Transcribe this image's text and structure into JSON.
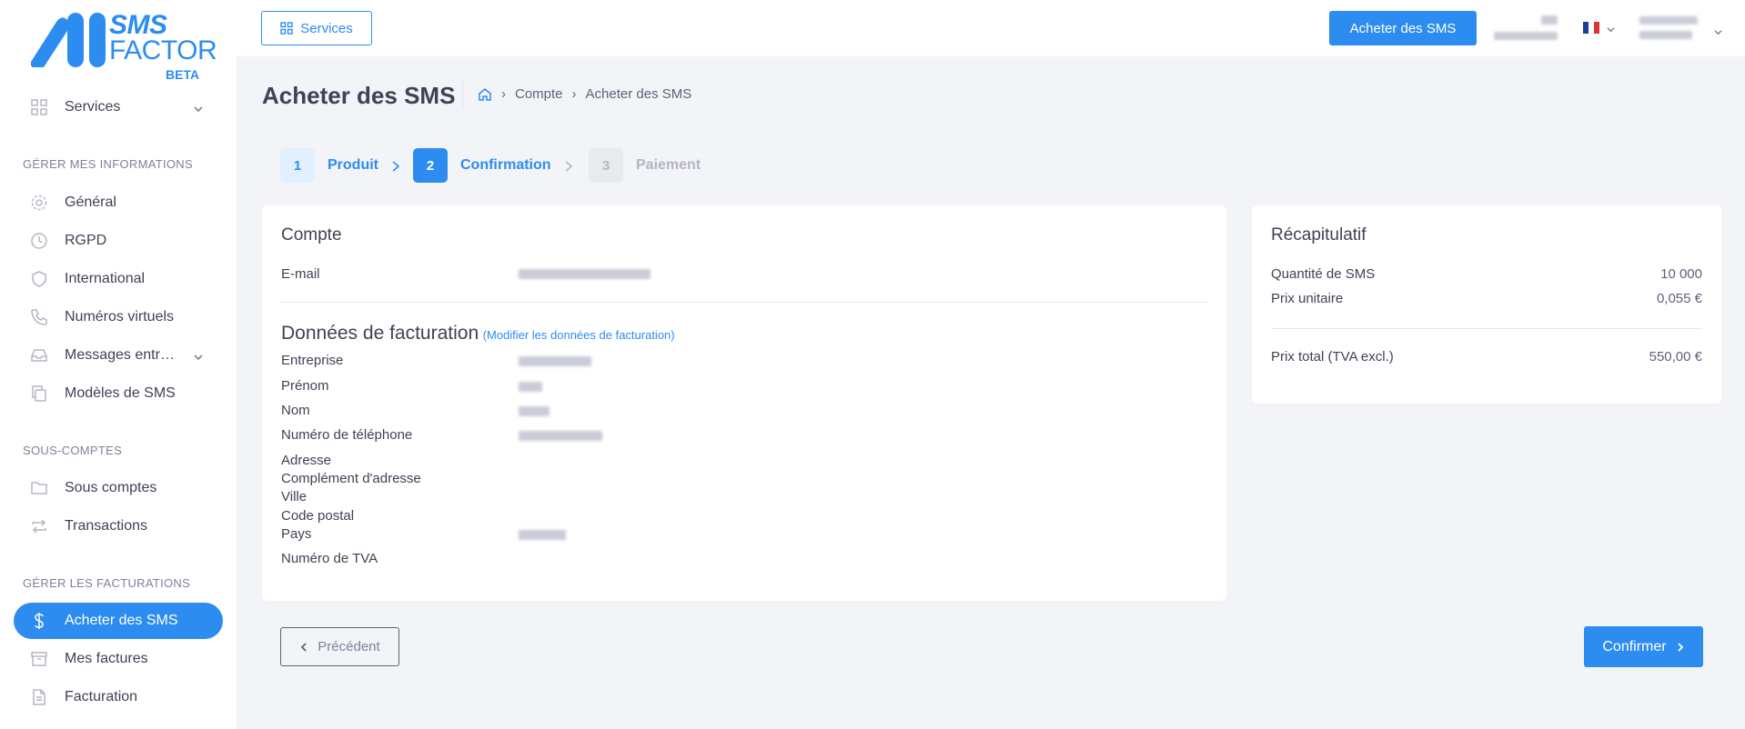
{
  "brand": {
    "line1": "SMS",
    "line2": "FACTOR",
    "badge": "BETA"
  },
  "sidebar": {
    "services": {
      "label": "Services",
      "icon": "grid-icon"
    },
    "sections": [
      {
        "title": "GÉRER MES INFORMATIONS"
      },
      {
        "title": "SOUS-COMPTES"
      },
      {
        "title": "GÉRER LES FACTURATIONS"
      }
    ],
    "items": [
      {
        "label": "Général",
        "icon": "gear-icon"
      },
      {
        "label": "RGPD",
        "icon": "clock-icon"
      },
      {
        "label": "International",
        "icon": "shield-icon"
      },
      {
        "label": "Numéros virtuels",
        "icon": "phone-icon"
      },
      {
        "label": "Messages entr…",
        "icon": "inbox-icon"
      },
      {
        "label": "Modèles de SMS",
        "icon": "copy-icon"
      },
      {
        "label": "Sous comptes",
        "icon": "folder-icon"
      },
      {
        "label": "Transactions",
        "icon": "repeat-icon"
      },
      {
        "label": "Acheter des SMS",
        "icon": "dollar-icon"
      },
      {
        "label": "Mes factures",
        "icon": "archive-icon"
      },
      {
        "label": "Facturation",
        "icon": "file-icon"
      }
    ]
  },
  "topbar": {
    "services_label": "Services",
    "buy_label": "Acheter des SMS"
  },
  "page": {
    "title": "Acheter des SMS",
    "breadcrumb": [
      "Compte",
      "Acheter des SMS"
    ]
  },
  "steps": [
    {
      "num": "1",
      "label": "Produit"
    },
    {
      "num": "2",
      "label": "Confirmation"
    },
    {
      "num": "3",
      "label": "Paiement"
    }
  ],
  "account": {
    "title": "Compte",
    "email_label": "E-mail"
  },
  "billing": {
    "title": "Données de facturation",
    "edit_link": "(Modifier les données de facturation)",
    "fields": {
      "company": "Entreprise",
      "firstname": "Prénom",
      "lastname": "Nom",
      "phone": "Numéro de téléphone",
      "address": "Adresse",
      "address2": "Complément d'adresse",
      "city": "Ville",
      "zip": "Code postal",
      "country": "Pays",
      "vat": "Numéro de TVA"
    }
  },
  "summary": {
    "title": "Récapitulatif",
    "qty_label": "Quantité de SMS",
    "qty_value": "10 000",
    "unit_label": "Prix unitaire",
    "unit_value": "0,055 €",
    "total_label": "Prix total (TVA excl.)",
    "total_value": "550,00 €"
  },
  "actions": {
    "prev": "Précédent",
    "confirm": "Confirmer"
  },
  "colors": {
    "primary": "#2d8cf0",
    "background": "#f3f4f8",
    "muted": "#b5b5c3"
  }
}
